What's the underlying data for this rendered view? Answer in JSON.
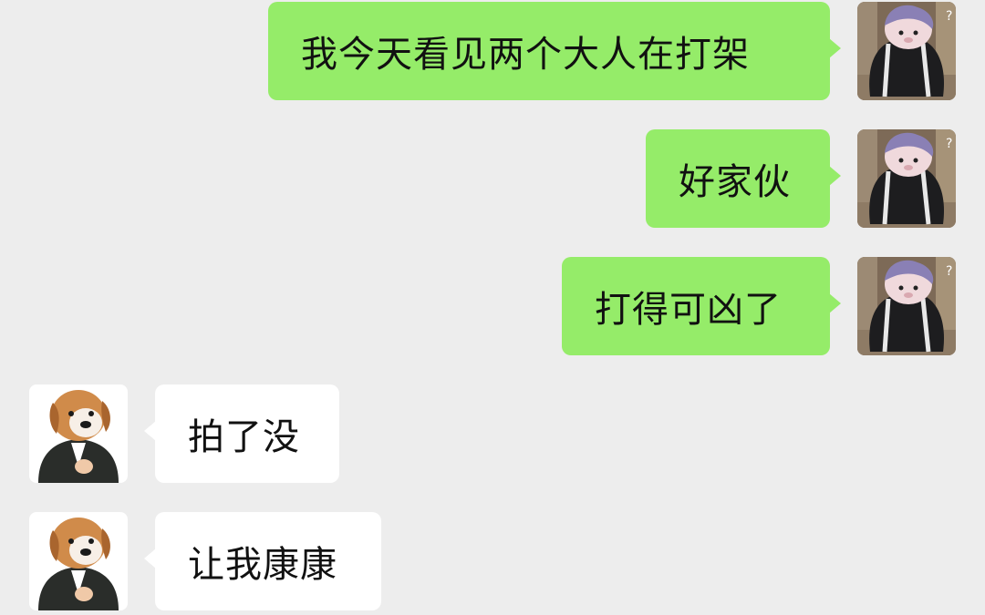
{
  "colors": {
    "background": "#ededed",
    "outgoing_bubble": "#95ec69",
    "incoming_bubble": "#ffffff",
    "text": "#111111"
  },
  "messages": [
    {
      "direction": "outgoing",
      "sender_avatar": "cat-in-black-jacket-avatar",
      "text": "我今天看见两个大人在打架"
    },
    {
      "direction": "outgoing",
      "sender_avatar": "cat-in-black-jacket-avatar",
      "text": "好家伙"
    },
    {
      "direction": "outgoing",
      "sender_avatar": "cat-in-black-jacket-avatar",
      "text": "打得可凶了"
    },
    {
      "direction": "incoming",
      "sender_avatar": "dog-in-suit-avatar",
      "text": "拍了没"
    },
    {
      "direction": "incoming",
      "sender_avatar": "dog-in-suit-avatar",
      "text": "让我康康"
    }
  ]
}
